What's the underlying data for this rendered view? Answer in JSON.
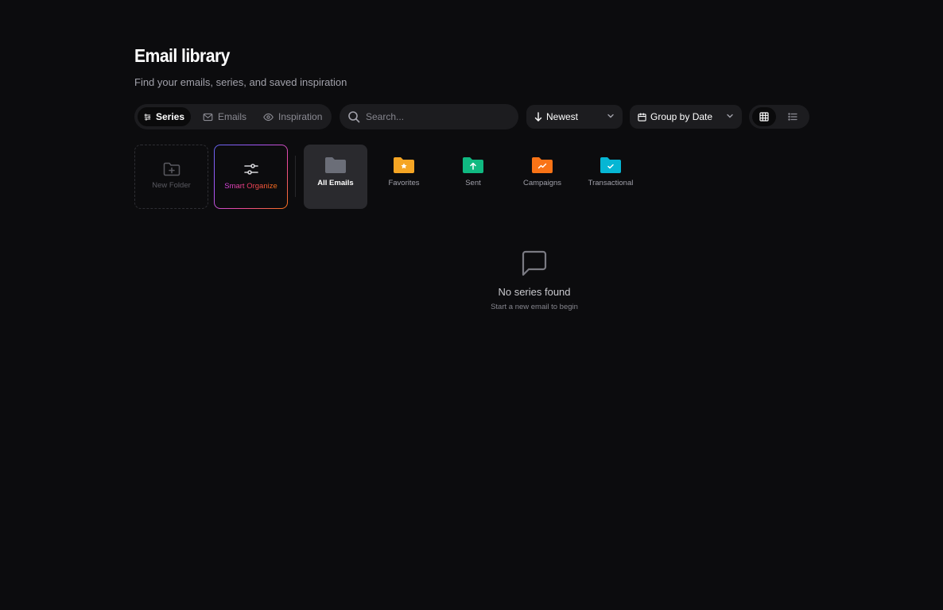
{
  "header": {
    "title": "Email library",
    "subtitle": "Find your emails, series, and saved inspiration"
  },
  "tabs": [
    {
      "label": "Series",
      "icon": "series-icon",
      "active": true
    },
    {
      "label": "Emails",
      "icon": "mail-icon",
      "active": false
    },
    {
      "label": "Inspiration",
      "icon": "eye-icon",
      "active": false
    }
  ],
  "search": {
    "placeholder": "Search...",
    "value": ""
  },
  "sort": {
    "label": "Newest",
    "icon": "arrow-down-icon"
  },
  "group": {
    "label": "Group by Date",
    "icon": "calendar-icon"
  },
  "view": {
    "active": "grid",
    "options": [
      "grid-icon",
      "list-icon"
    ]
  },
  "actions": {
    "new_folder": "New Folder",
    "smart_organize": "Smart Organize"
  },
  "folders": [
    {
      "label": "All Emails",
      "color": "#6b6e78",
      "active": true
    },
    {
      "label": "Favorites",
      "color": "#f5a524",
      "badge": "star-icon"
    },
    {
      "label": "Sent",
      "color": "#10b981",
      "badge": "arrow-up-icon"
    },
    {
      "label": "Campaigns",
      "color": "#f97316",
      "badge": "trend-icon"
    },
    {
      "label": "Transactional",
      "color": "#06b6d4",
      "badge": "check-icon"
    }
  ],
  "empty_state": {
    "icon": "message-square-icon",
    "title": "No series found",
    "hint": "Start a new email to begin"
  },
  "colors": {
    "background": "#0c0c0e",
    "surface": "#1c1c1f",
    "accent_gradient": [
      "#6366f1",
      "#ec4899",
      "#f97316"
    ]
  }
}
